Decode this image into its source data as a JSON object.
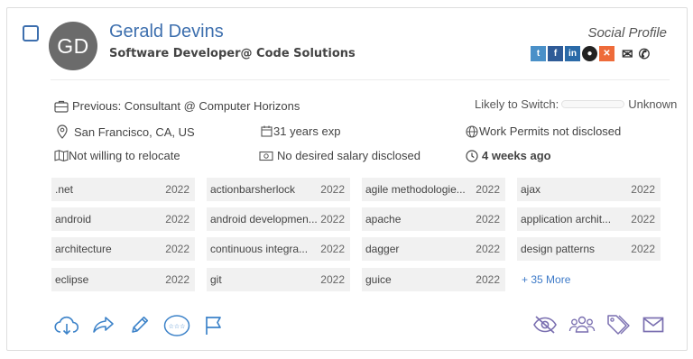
{
  "candidate": {
    "name": "Gerald Devins",
    "initials": "GD",
    "headline": "Software Developer@ Code Solutions"
  },
  "social": {
    "label": "Social Profile",
    "icons": [
      "twitter-icon",
      "facebook-icon",
      "linkedin-icon",
      "github-icon",
      "xing-icon",
      "email-icon",
      "phone-icon"
    ]
  },
  "details": {
    "previous": "Previous: Consultant @ Computer Horizons",
    "switch_label": "Likely to Switch:",
    "switch_value": "Unknown",
    "location": "San Francisco, CA, US",
    "experience": "31 years exp",
    "work_permits": "Work Permits not disclosed",
    "relocate": "Not willing to relocate",
    "salary": "No desired salary disclosed",
    "last_active": "4 weeks ago"
  },
  "skills": [
    {
      "name": ".net",
      "year": "2022"
    },
    {
      "name": "actionbarsherlock",
      "year": "2022"
    },
    {
      "name": "agile methodologie...",
      "year": "2022"
    },
    {
      "name": "ajax",
      "year": "2022"
    },
    {
      "name": "android",
      "year": "2022"
    },
    {
      "name": "android developmen...",
      "year": "2022"
    },
    {
      "name": "apache",
      "year": "2022"
    },
    {
      "name": "application archit...",
      "year": "2022"
    },
    {
      "name": "architecture",
      "year": "2022"
    },
    {
      "name": "continuous integra...",
      "year": "2022"
    },
    {
      "name": "dagger",
      "year": "2022"
    },
    {
      "name": "design patterns",
      "year": "2022"
    },
    {
      "name": "eclipse",
      "year": "2022"
    },
    {
      "name": "git",
      "year": "2022"
    },
    {
      "name": "guice",
      "year": "2022"
    }
  ],
  "more_skills": "+ 35 More",
  "actions_left": [
    "download-icon",
    "share-icon",
    "edit-icon",
    "rate-icon",
    "flag-icon"
  ],
  "actions_right": [
    "hide-icon",
    "group-icon",
    "tags-icon",
    "message-icon"
  ],
  "colors": {
    "accent": "#3d6fae",
    "action_blue": "#3d83c9",
    "action_purple": "#7a6fb0",
    "chip_bg": "#f1f1f1"
  }
}
